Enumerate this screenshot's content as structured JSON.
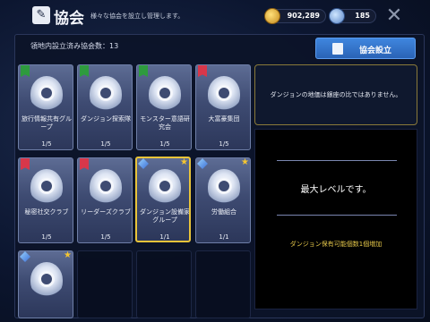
{
  "header": {
    "title": "協会",
    "subtitle": "様々な協会を設立し管理します。",
    "gold": "902,289",
    "gems": "185"
  },
  "panel": {
    "count_label": "領地内設立済み協会数：13",
    "setup_button": "協会設立"
  },
  "associations": [
    {
      "name": "旅行情報共有グループ",
      "level": "1/5",
      "tag": "green",
      "selected": false
    },
    {
      "name": "ダンジョン探索隊",
      "level": "1/5",
      "tag": "green",
      "selected": false
    },
    {
      "name": "モンスター意語研究会",
      "level": "1/5",
      "tag": "green",
      "selected": false
    },
    {
      "name": "大富豪集団",
      "level": "1/5",
      "tag": "red",
      "selected": false
    },
    {
      "name": "秘密社交クラブ",
      "level": "1/5",
      "tag": "red",
      "selected": false
    },
    {
      "name": "リーダーズクラブ",
      "level": "1/5",
      "tag": "red",
      "selected": false
    },
    {
      "name": "ダンジョン設備家グループ",
      "level": "1/1",
      "tag": "blue",
      "selected": true
    },
    {
      "name": "労働組合",
      "level": "1/1",
      "tag": "blue",
      "selected": false
    },
    {
      "name": "",
      "level": "",
      "tag": "blue",
      "selected": false
    }
  ],
  "info": {
    "message": "ダンジョンの地価は銀座の比ではありません。"
  },
  "detail": {
    "max_level": "最大レベルです。",
    "bonus": "ダンジョン保有可能個数1個増加"
  },
  "colors": {
    "accent_blue": "#3f86de",
    "selected_border": "#e9c43a",
    "bonus_text": "#e6c84a",
    "tag_green": "#2e9b3e",
    "tag_red": "#d8374a"
  }
}
